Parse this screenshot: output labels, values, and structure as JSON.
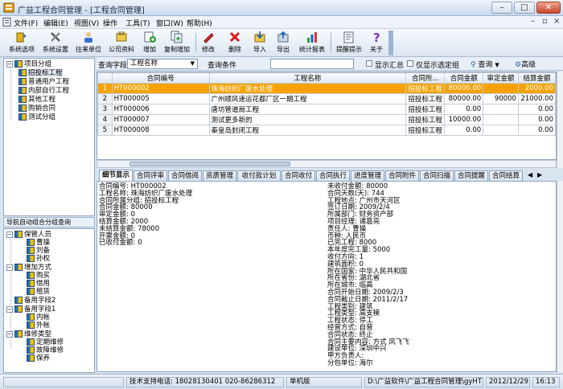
{
  "window": {
    "title": "广益工程合同管理 - [工程合同管理]"
  },
  "menu": [
    "文件(F)",
    "编辑(E)",
    "视图(V)",
    "操作",
    "工具(T)",
    "窗口(W)",
    "帮助(H)"
  ],
  "toolbar": [
    {
      "label": "系统选项",
      "icon": "settings-icon"
    },
    {
      "label": "系统设置",
      "icon": "tools-icon"
    },
    {
      "label": "往来单位",
      "icon": "partner-icon"
    },
    {
      "label": "公司资料",
      "icon": "company-icon"
    },
    {
      "label": "增加",
      "icon": "add-icon"
    },
    {
      "label": "复制增加",
      "icon": "copy-add-icon"
    },
    {
      "label": "修改",
      "icon": "edit-icon"
    },
    {
      "label": "删除",
      "icon": "delete-icon"
    },
    {
      "label": "导入",
      "icon": "import-icon"
    },
    {
      "label": "导出",
      "icon": "export-icon"
    },
    {
      "label": "统计报表",
      "icon": "report-icon"
    },
    {
      "label": "提醒提示",
      "icon": "reminder-icon"
    },
    {
      "label": "关于",
      "icon": "help-icon"
    }
  ],
  "tree1": {
    "root": "项目分组",
    "items": [
      "招投标工程",
      "普通用户工程",
      "内部自行工程",
      "其他工程",
      "购销合同",
      "测试分组"
    ]
  },
  "nav_caption": "导航自动组合分组查询",
  "tree2": [
    {
      "label": "保管人员",
      "children": [
        "曹操",
        "刘备",
        "孙权"
      ]
    },
    {
      "label": "增加方式",
      "children": [
        "购买",
        "借用",
        "租赁"
      ]
    },
    {
      "label": "备用字段2",
      "children": []
    },
    {
      "label": "备用字段1",
      "children": [
        "内帐",
        "外帐"
      ]
    },
    {
      "label": "维修类型",
      "children": [
        "定期维修",
        "故障维修",
        "保养"
      ]
    }
  ],
  "filter": {
    "field_label": "查询字段",
    "field_value": "工程名称",
    "cond_label": "查询条件",
    "cond_value": "",
    "show_sum": "显示汇总",
    "only_selected": "仅显示选定组",
    "query": "查询",
    "advanced": "高级"
  },
  "grid": {
    "headers": [
      "",
      "合同编号",
      "工程名称",
      "合同所...",
      "合同金额",
      "审定金额",
      "结算金额"
    ],
    "rows": [
      [
        "1",
        "HT000002",
        "珠海纺织厂废水处理",
        "招投标工程",
        "80000.00",
        "",
        "2000.00"
      ],
      [
        "2",
        "HT000005",
        "广州顺风速运花都厂区一期工程",
        "招投标工程",
        "80000.00",
        "90000",
        "21000.00"
      ],
      [
        "3",
        "HT000006",
        "唐坊管道局工程",
        "招投标工程",
        "0.00",
        "",
        "0.00"
      ],
      [
        "4",
        "HT000007",
        "测试更多新的",
        "招投标工程",
        "10000.00",
        "",
        "0.00"
      ],
      [
        "5",
        "HT000008",
        "秦皇岛封闭工程",
        "招投标工程",
        "0.00",
        "",
        "0.00"
      ]
    ]
  },
  "tabs": [
    "细节显示",
    "合同评审",
    "合同借阅",
    "资质管理",
    "收付款计划",
    "合同收付",
    "合同执行",
    "进度管理",
    "合同附件",
    "合同扫描",
    "合同提醒",
    "合同结算"
  ],
  "detail_left": [
    "合同编号: HT000002",
    "工程名称: 珠海纺织厂废水处理",
    "合同所属分组: 招投标工程",
    "合同金额: 80000",
    "审定金额: 0",
    "结算金额: 2000",
    "未结算金额: 78000",
    "开票金额: 0",
    "已收付金额: 0"
  ],
  "detail_right": [
    "未收付金额: 80000",
    "合同天数(天): 744",
    "工程地点: 广州市天河区",
    "签订日期: 2009/2/4",
    "所属部门: 财务资产部",
    "项目经理: 诸葛亮",
    "责任人: 曹操",
    "币种: 人民币",
    "已完工程: 8000",
    "本年度完工量: 5000",
    "收付方向: 1",
    "建筑面积: 0",
    "所在国家: 中华人民共和国",
    "所在省份: 湖北省",
    "所在城市: 临高",
    "合同开始日期: 2009/2/3",
    "合同截止日期: 2011/2/17",
    "工程类别: 建筑",
    "工程类型: 高支模",
    "工程状态: 停工",
    "经营方式: 自营",
    "合同状态: 终止",
    "合同主要内容: 方式 风飞飞",
    "建设单位: 深圳中兴",
    "甲方负责人:",
    "分包单位: 海尔"
  ],
  "status": {
    "support": "技术支持电话: 18028130401 020-86286312",
    "mode": "单机版",
    "path": "D:\\广益软件\\广益工程合同管理\\gyHT",
    "date": "2012/12/29",
    "time": "16:13"
  }
}
